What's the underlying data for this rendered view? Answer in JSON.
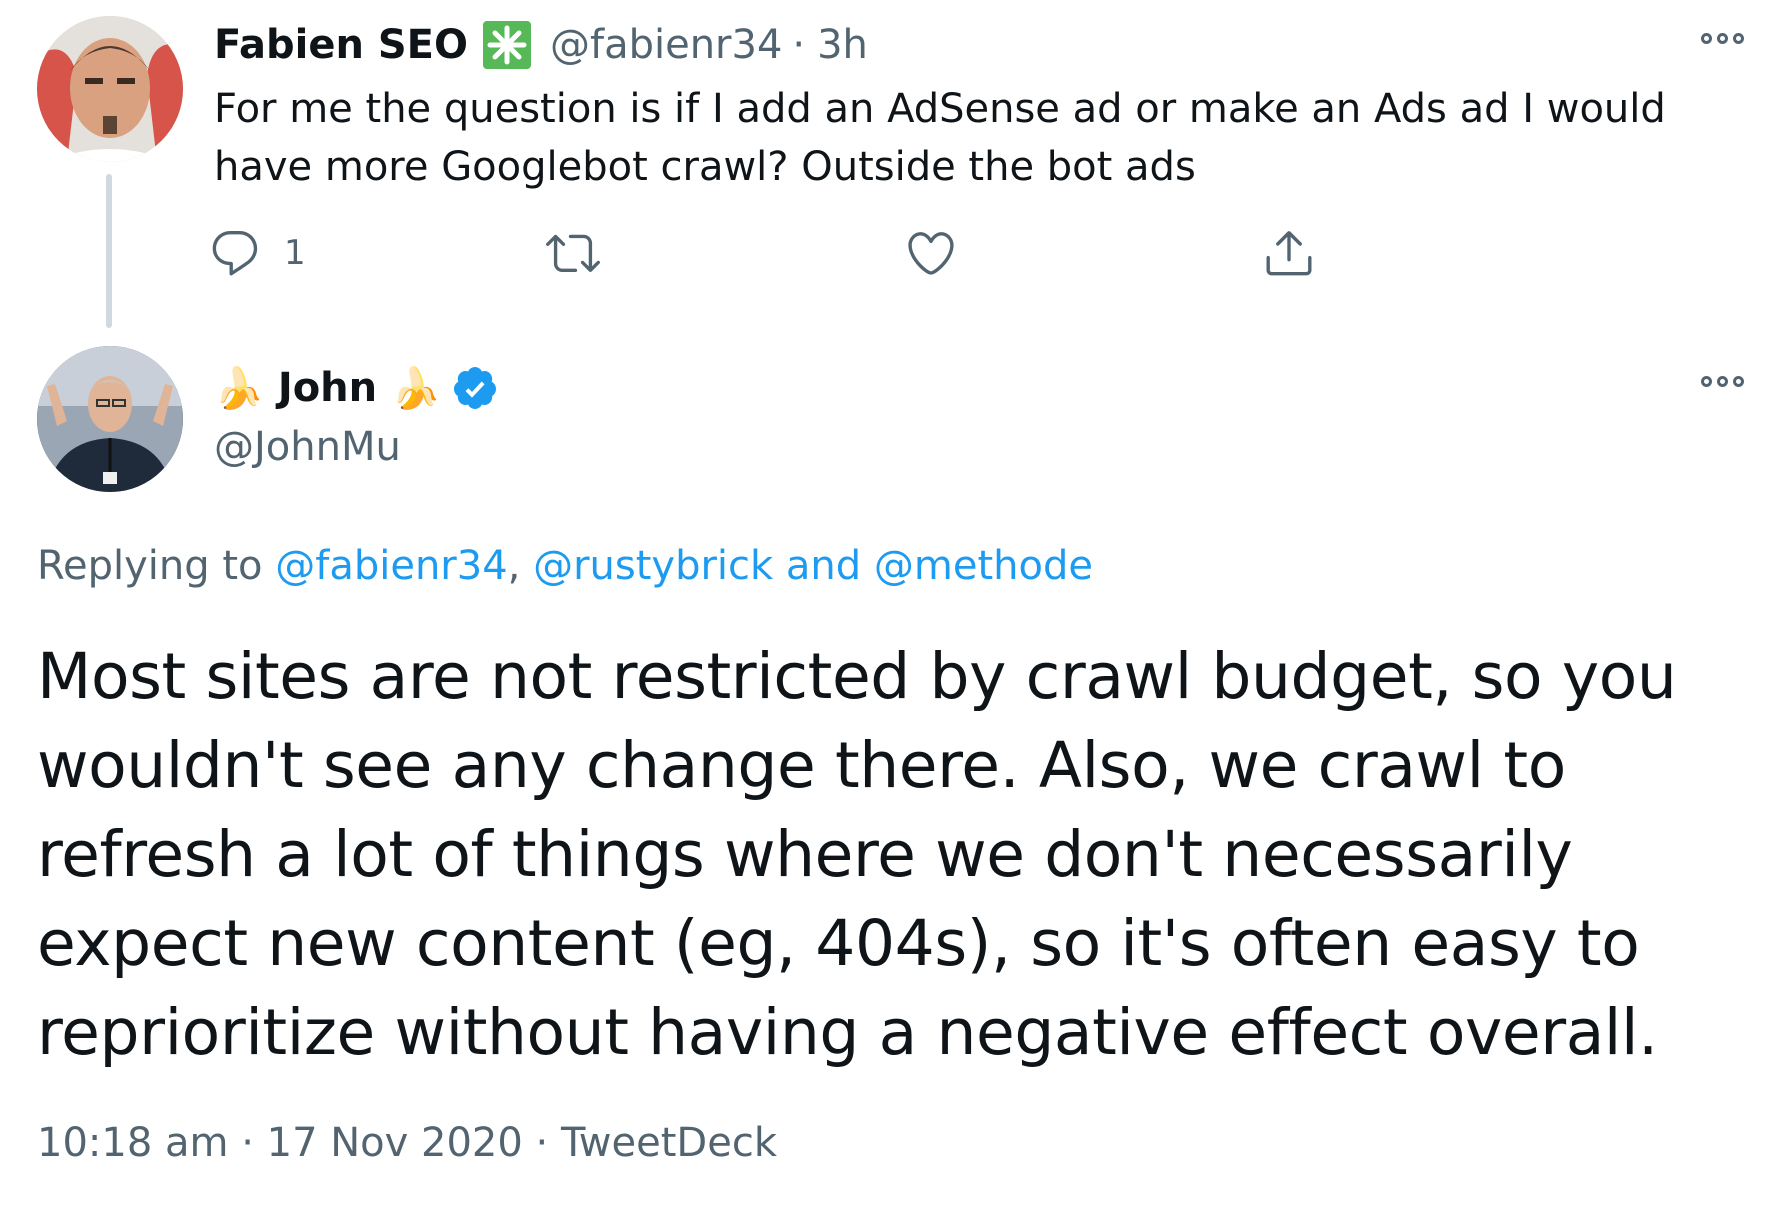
{
  "reply_tweet": {
    "author_name": "Fabien SEO",
    "badge_icon": "green-asterisk-badge",
    "handle": "@fabienr34",
    "separator": "·",
    "time": "3h",
    "text": "For me the question is if I add an AdSense ad or make an Ads ad I would have more Googlebot crawl? Outside the bot ads",
    "reply_count": "1"
  },
  "main_tweet": {
    "name_prefix_emoji": "🍌",
    "author_name": "John",
    "name_suffix_emoji": "🍌",
    "verified_icon": "verified-badge",
    "handle": "@JohnMu",
    "replying_prefix": "Replying to",
    "mention_1": "@fabienr34",
    "mention_sep": ",",
    "mention_2": "@rustybrick",
    "mention_and": "and",
    "mention_3": "@methode",
    "text": "Most sites are not restricted by crawl budget, so you wouldn't see any change there. Also, we crawl to refresh a lot of things where we don't necessarily expect new content (eg, 404s), so it's often easy to reprioritize without having a negative effect overall.",
    "time": "10:18 am",
    "sep1": "·",
    "date": "17 Nov 2020",
    "sep2": "·",
    "source": "TweetDeck"
  },
  "colors": {
    "link": "#1d9bf0",
    "secondary_text": "#536471",
    "primary_text": "#0f1419",
    "badge_green": "#56b856",
    "verified_blue": "#1d9bf0"
  }
}
